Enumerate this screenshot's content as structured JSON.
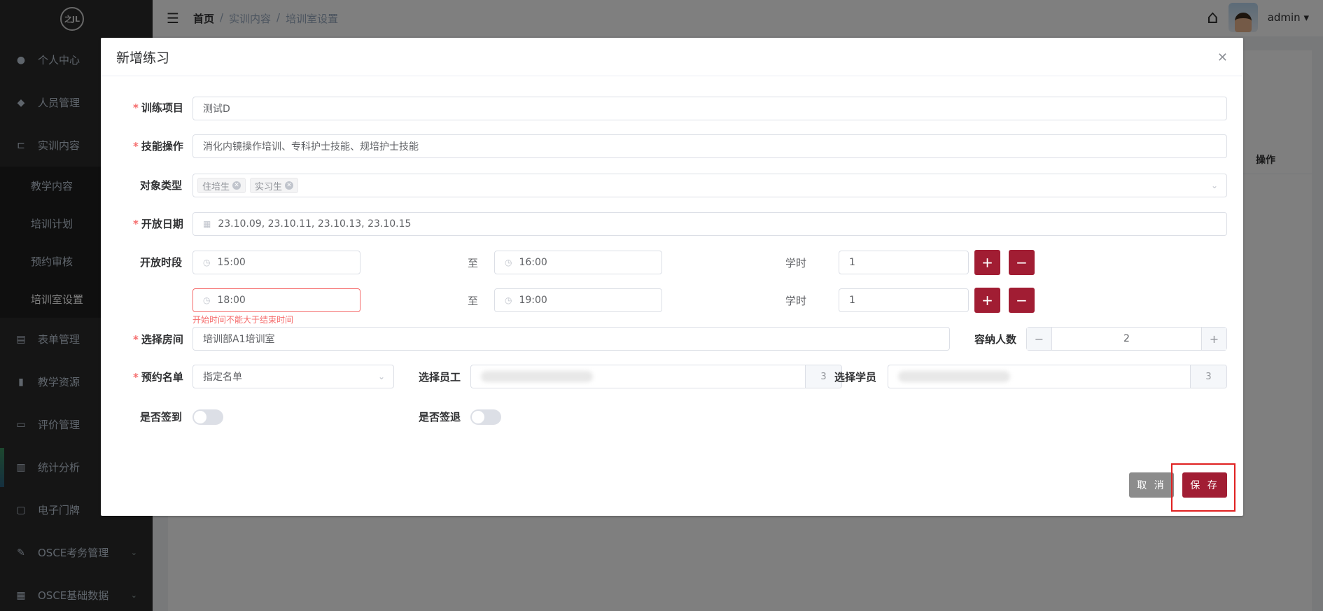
{
  "sidebar": {
    "logo": "之JL",
    "items": [
      {
        "label": "个人中心",
        "icon": "user-icon"
      },
      {
        "label": "人员管理",
        "icon": "users-icon"
      },
      {
        "label": "实训内容",
        "icon": "tree-icon"
      }
    ],
    "submenu": [
      "教学内容",
      "培训计划",
      "预约审核",
      "培训室设置"
    ],
    "items_after": [
      {
        "label": "表单管理",
        "icon": "form-icon"
      },
      {
        "label": "教学资源",
        "icon": "book-icon"
      },
      {
        "label": "评价管理",
        "icon": "rating-icon"
      },
      {
        "label": "统计分析",
        "icon": "chart-icon"
      },
      {
        "label": "电子门牌",
        "icon": "monitor-icon"
      },
      {
        "label": "OSCE考务管理",
        "icon": "edit-icon"
      },
      {
        "label": "OSCE基础数据",
        "icon": "grid-icon"
      }
    ]
  },
  "header": {
    "breadcrumb": [
      "首页",
      "/",
      "实训内容",
      "/",
      "培训室设置"
    ],
    "user": "admin",
    "table_col": "操作"
  },
  "dialog": {
    "title": "新增练习",
    "labels": {
      "project": "训练项目",
      "skill": "技能操作",
      "target": "对象类型",
      "date": "开放日期",
      "period": "开放时段",
      "room": "选择房间",
      "capacity": "容纳人数",
      "list": "预约名单",
      "staff": "选择员工",
      "student": "选择学员",
      "signin": "是否签到",
      "signout": "是否签退",
      "to": "至",
      "hours": "学时"
    },
    "values": {
      "project": "测试D",
      "skill": "消化内镜操作培训、专科护士技能、规培护士技能",
      "tags": [
        "住培生",
        "实习生"
      ],
      "date": "23.10.09, 23.10.11, 23.10.13, 23.10.15",
      "slots": [
        {
          "start": "15:00",
          "end": "16:00",
          "hours": "1"
        },
        {
          "start": "18:00",
          "end": "19:00",
          "hours": "1"
        }
      ],
      "error": "开始时间不能大于结束时间",
      "room": "培训部A1培训室",
      "capacity": "2",
      "list": "指定名单",
      "staff_count": "3",
      "student_count": "3",
      "signin": false,
      "signout": false
    },
    "buttons": {
      "cancel": "取 消",
      "save": "保 存"
    }
  },
  "colors": {
    "primary": "#a11d33",
    "sidebar": "#2b2b2b",
    "error": "#f56c6c",
    "highlight": "#e02020"
  }
}
